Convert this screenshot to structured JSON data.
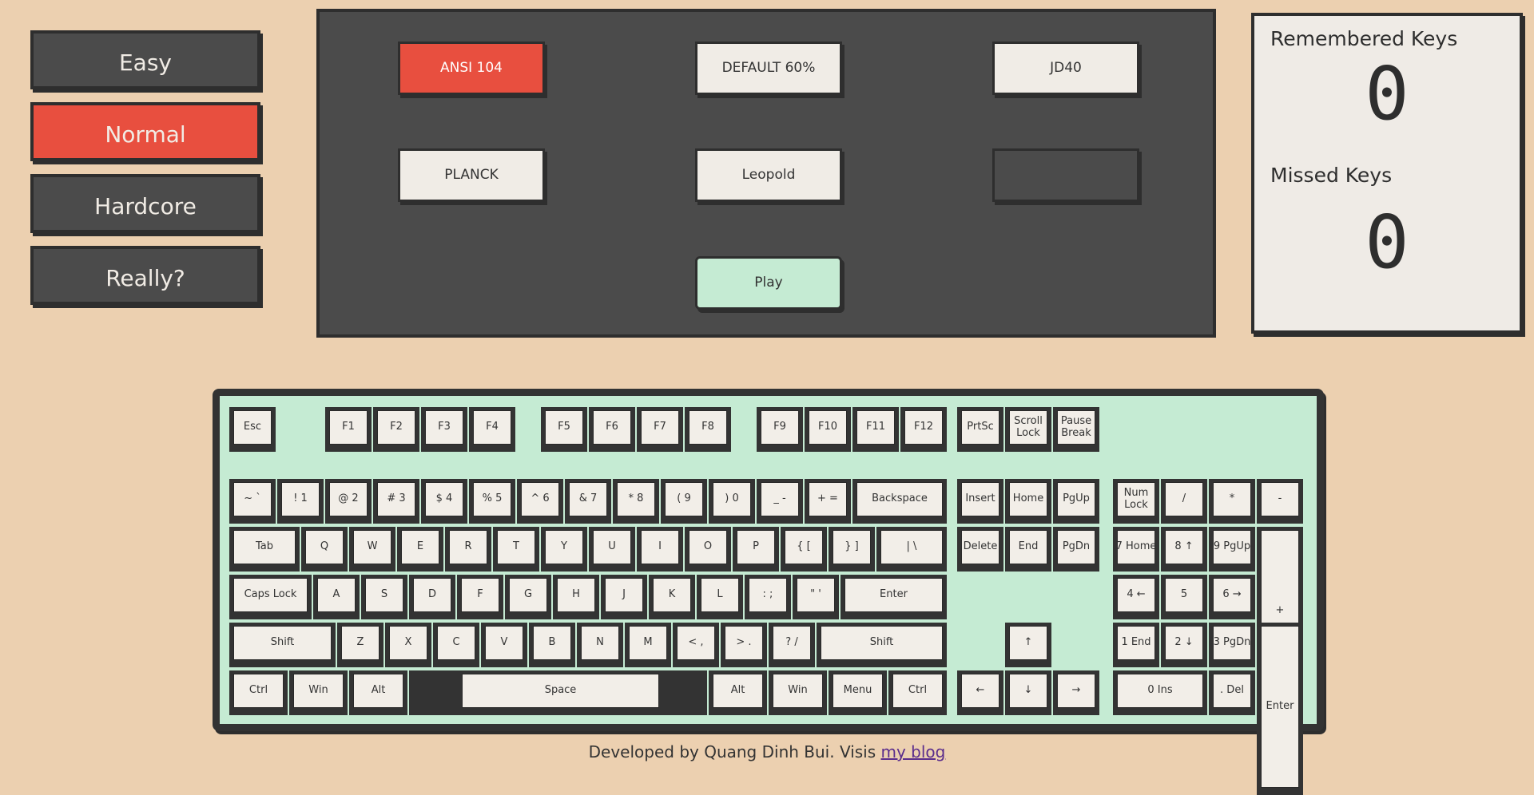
{
  "difficulty": {
    "items": [
      {
        "label": "Easy",
        "active": false
      },
      {
        "label": "Normal",
        "active": true
      },
      {
        "label": "Hardcore",
        "active": false
      },
      {
        "label": "Really?",
        "active": false
      }
    ]
  },
  "layouts": {
    "items": [
      {
        "label": "ANSI 104",
        "active": true
      },
      {
        "label": "DEFAULT 60%",
        "active": false
      },
      {
        "label": "JD40",
        "active": false
      },
      {
        "label": "PLANCK",
        "active": false
      },
      {
        "label": "Leopold",
        "active": false
      },
      {
        "label": "",
        "active": false
      }
    ],
    "play_label": "Play"
  },
  "stats": {
    "remembered_label": "Remembered Keys",
    "remembered_value": "0",
    "missed_label": "Missed Keys",
    "missed_value": "0"
  },
  "keyboard": {
    "keys": [
      "Esc",
      "F1",
      "F2",
      "F3",
      "F4",
      "F5",
      "F6",
      "F7",
      "F8",
      "F9",
      "F10",
      "F11",
      "F12",
      "PrtSc",
      "Scroll Lock",
      "Pause Break",
      "~ `",
      "! 1",
      "@ 2",
      "# 3",
      "$ 4",
      "% 5",
      "^ 6",
      "& 7",
      "* 8",
      "( 9",
      ") 0",
      "_ -",
      "+ =",
      "Backspace",
      "Insert",
      "Home",
      "PgUp",
      "Num Lock",
      "/",
      "*",
      "-",
      "Tab",
      "Q",
      "W",
      "E",
      "R",
      "T",
      "Y",
      "U",
      "I",
      "O",
      "P",
      "{ [",
      "} ]",
      "| \\",
      "Delete",
      "End",
      "PgDn",
      "7 Home",
      "8 ↑",
      "9 PgUp",
      "+",
      "Caps Lock",
      "A",
      "S",
      "D",
      "F",
      "G",
      "H",
      "J",
      "K",
      "L",
      ": ;",
      "\" '",
      "Enter",
      "4 ←",
      "5",
      "6 →",
      "Shift",
      "Z",
      "X",
      "C",
      "V",
      "B",
      "N",
      "M",
      "< ,",
      "> .",
      "? /",
      "Shift",
      "↑",
      "1 End",
      "2 ↓",
      "3 PgDn",
      "Enter",
      "Ctrl",
      "Win",
      "Alt",
      "Space",
      "Alt",
      "Win",
      "Menu",
      "Ctrl",
      "←",
      "↓",
      "→",
      "0 Ins",
      ". Del"
    ]
  },
  "footer": {
    "text": "Developed by Quang Dinh Bui. Visis ",
    "link": "my blog"
  }
}
